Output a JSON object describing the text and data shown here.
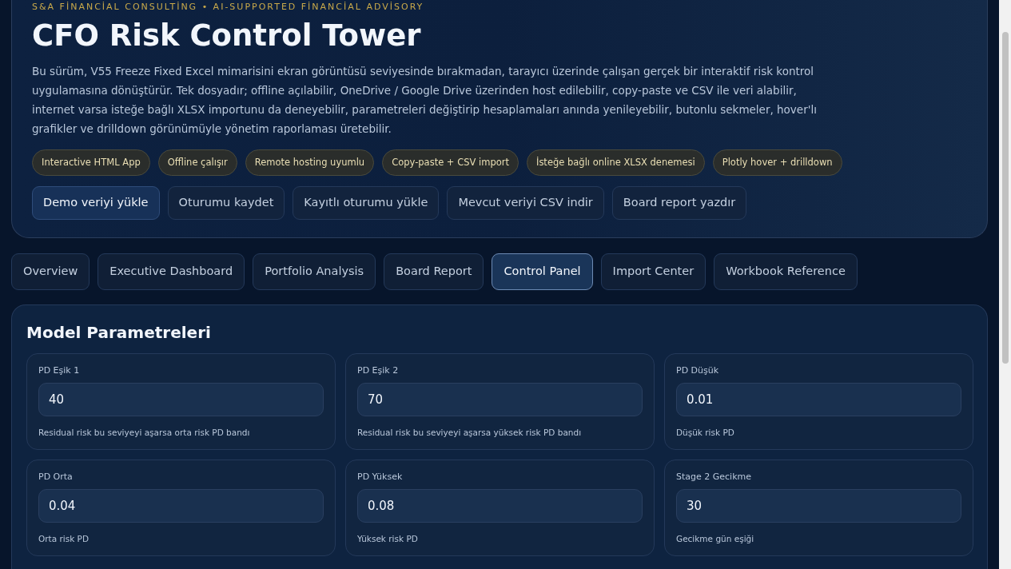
{
  "header": {
    "eyebrow": "S&A FİNANCİAL CONSULTİNG • AI-SUPPORTED FİNANCİAL ADVİSORY",
    "title": "CFO Risk Control Tower",
    "description": "Bu sürüm, V55 Freeze Fixed Excel mimarisini ekran görüntüsü seviyesinde bırakmadan, tarayıcı üzerinde çalışan gerçek bir interaktif risk kontrol uygulamasına dönüştürür. Tek dosyadır; offline açılabilir, OneDrive / Google Drive üzerinden host edilebilir, copy-paste ve CSV ile veri alabilir, internet varsa isteğe bağlı XLSX importunu da deneyebilir, parametreleri değiştirip hesaplamaları anında yenileyebilir, butonlu sekmeler, hover'lı grafikler ve drilldown görünümüyle yönetim raporlaması üretebilir.",
    "chips": [
      "Interactive HTML App",
      "Offline çalışır",
      "Remote hosting uyumlu",
      "Copy-paste + CSV import",
      "İsteğe bağlı online XLSX denemesi",
      "Plotly hover + drilldown"
    ],
    "buttons": [
      {
        "label": "Demo veriyi yükle",
        "kind": "primary"
      },
      {
        "label": "Oturumu kaydet",
        "kind": "secondary"
      },
      {
        "label": "Kayıtlı oturumu yükle",
        "kind": "secondary"
      },
      {
        "label": "Mevcut veriyi CSV indir",
        "kind": "secondary"
      },
      {
        "label": "Board report yazdır",
        "kind": "secondary"
      }
    ]
  },
  "tabs": [
    {
      "label": "Overview",
      "selected": false
    },
    {
      "label": "Executive Dashboard",
      "selected": false
    },
    {
      "label": "Portfolio Analysis",
      "selected": false
    },
    {
      "label": "Board Report",
      "selected": false
    },
    {
      "label": "Control Panel",
      "selected": true
    },
    {
      "label": "Import Center",
      "selected": false
    },
    {
      "label": "Workbook Reference",
      "selected": false
    }
  ],
  "panel": {
    "title": "Model Parametreleri",
    "fields": [
      {
        "label": "PD Eşik 1",
        "value": "40",
        "hint": "Residual risk bu seviyeyi aşarsa orta risk PD bandı"
      },
      {
        "label": "PD Eşik 2",
        "value": "70",
        "hint": "Residual risk bu seviyeyi aşarsa yüksek risk PD bandı"
      },
      {
        "label": "PD Düşük",
        "value": "0.01",
        "hint": "Düşük risk PD"
      },
      {
        "label": "PD Orta",
        "value": "0.04",
        "hint": "Orta risk PD"
      },
      {
        "label": "PD Yüksek",
        "value": "0.08",
        "hint": "Yüksek risk PD"
      },
      {
        "label": "Stage 2 Gecikme",
        "value": "30",
        "hint": "Gecikme gün eşiği"
      }
    ]
  }
}
